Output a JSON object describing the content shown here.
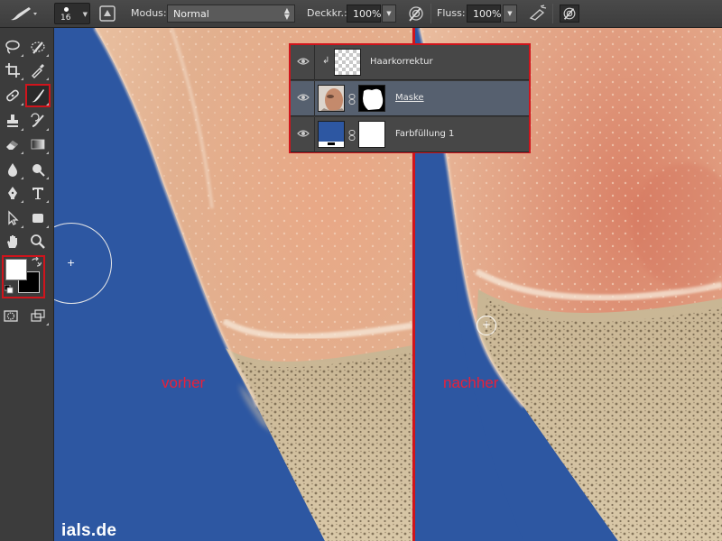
{
  "options_bar": {
    "brush_size": "16",
    "mode_label": "Modus:",
    "mode_value": "Normal",
    "opacity_label": "Deckkr.:",
    "opacity_value": "100%",
    "flow_label": "Fluss:",
    "flow_value": "100%"
  },
  "toolbox": {
    "tools": [
      "lasso-tool",
      "quick-selection-tool",
      "crop-tool",
      "eyedropper-tool",
      "spot-healing-brush-tool",
      "brush-tool",
      "clone-stamp-tool",
      "history-brush-tool",
      "eraser-tool",
      "gradient-tool",
      "blur-tool",
      "dodge-tool",
      "pen-tool",
      "type-tool",
      "path-selection-tool",
      "shape-tool",
      "hand-tool",
      "zoom-tool"
    ],
    "active_tool": "brush-tool",
    "foreground_color": "#ffffff",
    "background_color": "#000000"
  },
  "canvas": {
    "caption_before": "vorher",
    "caption_after": "nachher",
    "watermark": "ials.de",
    "background_color": "#2d57a2",
    "highlight_color": "#d0141c"
  },
  "layers": [
    {
      "name": "Haarkorrektur",
      "visible": true,
      "clipped": true,
      "thumb": "transparent"
    },
    {
      "name": "Maske",
      "visible": true,
      "selected": true,
      "thumb": "photo",
      "mask": "white-shape-on-black"
    },
    {
      "name": "Farbfüllung 1",
      "visible": true,
      "thumb": "color-fill",
      "mask": "white"
    }
  ]
}
